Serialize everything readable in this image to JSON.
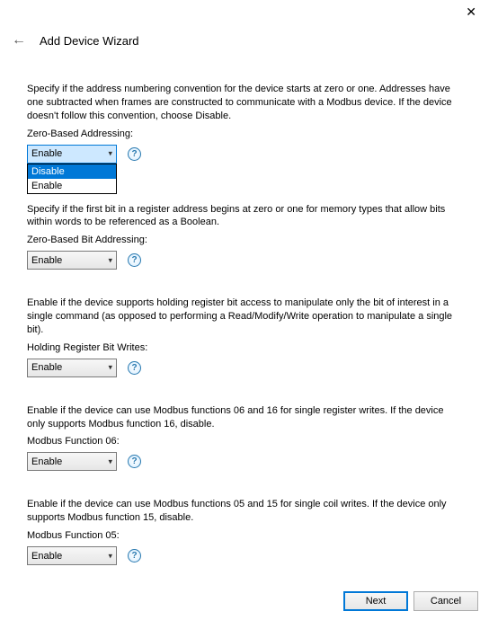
{
  "window": {
    "title": "Add Device Wizard",
    "close_glyph": "✕",
    "back_glyph": "←"
  },
  "sections": {
    "zero_addr": {
      "desc": "Specify if the address numbering convention for the device starts at zero or one. Addresses have one subtracted when frames are constructed to communicate with a Modbus device. If the device doesn't follow this convention, choose Disable.",
      "label": "Zero-Based Addressing:",
      "value": "Enable",
      "options": [
        "Disable",
        "Enable"
      ],
      "selected_option": "Disable"
    },
    "zero_bit": {
      "desc": "Specify if the first bit in a register address begins at zero or one for memory types that allow bits within words to be referenced as a Boolean.",
      "label": "Zero-Based Bit Addressing:",
      "value": "Enable"
    },
    "holding_reg": {
      "desc": "Enable if the device supports holding register bit access to manipulate only the bit of interest in a single command (as opposed to performing a Read/Modify/Write operation to manipulate a single bit).",
      "label": "Holding Register Bit Writes:",
      "value": "Enable"
    },
    "func06": {
      "desc": "Enable if the device can use Modbus functions 06 and 16 for single register writes. If the device only supports Modbus function 16, disable.",
      "label": "Modbus Function 06:",
      "value": "Enable"
    },
    "func05": {
      "desc": "Enable if the device can use Modbus functions 05 and 15 for single coil writes. If the device only supports Modbus function 15, disable.",
      "label": "Modbus Function 05:",
      "value": "Enable"
    }
  },
  "help_glyph": "?",
  "arrow_glyph": "▾",
  "footer": {
    "next": "Next",
    "cancel": "Cancel"
  }
}
